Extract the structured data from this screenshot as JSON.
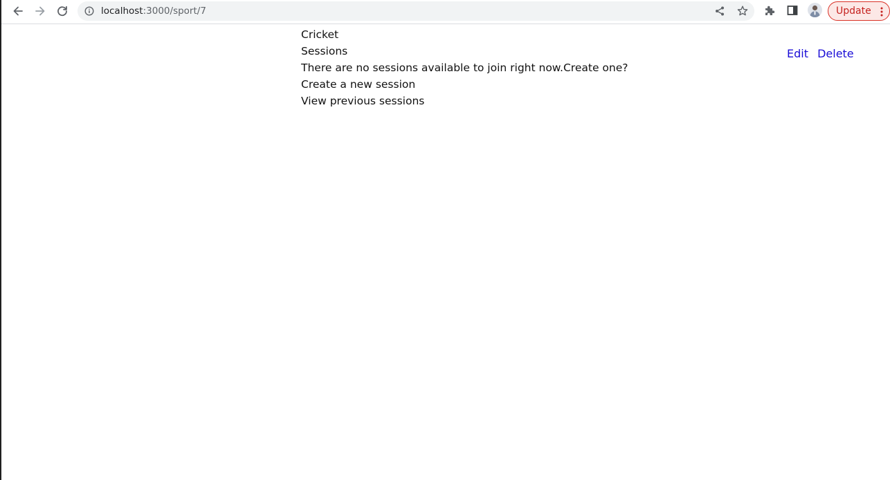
{
  "browser": {
    "url_host": "localhost",
    "url_path": ":3000/sport/7",
    "update_label": "Update"
  },
  "page": {
    "title": "Cricket",
    "sessions_heading": "Sessions",
    "no_sessions_text": "There are no sessions available to join right now.Create one?",
    "create_link": "Create a new session",
    "previous_link": "View previous sessions",
    "edit_link": "Edit",
    "delete_link": "Delete"
  },
  "colors": {
    "link": "#1a0dd6",
    "update_accent": "#d93025"
  }
}
